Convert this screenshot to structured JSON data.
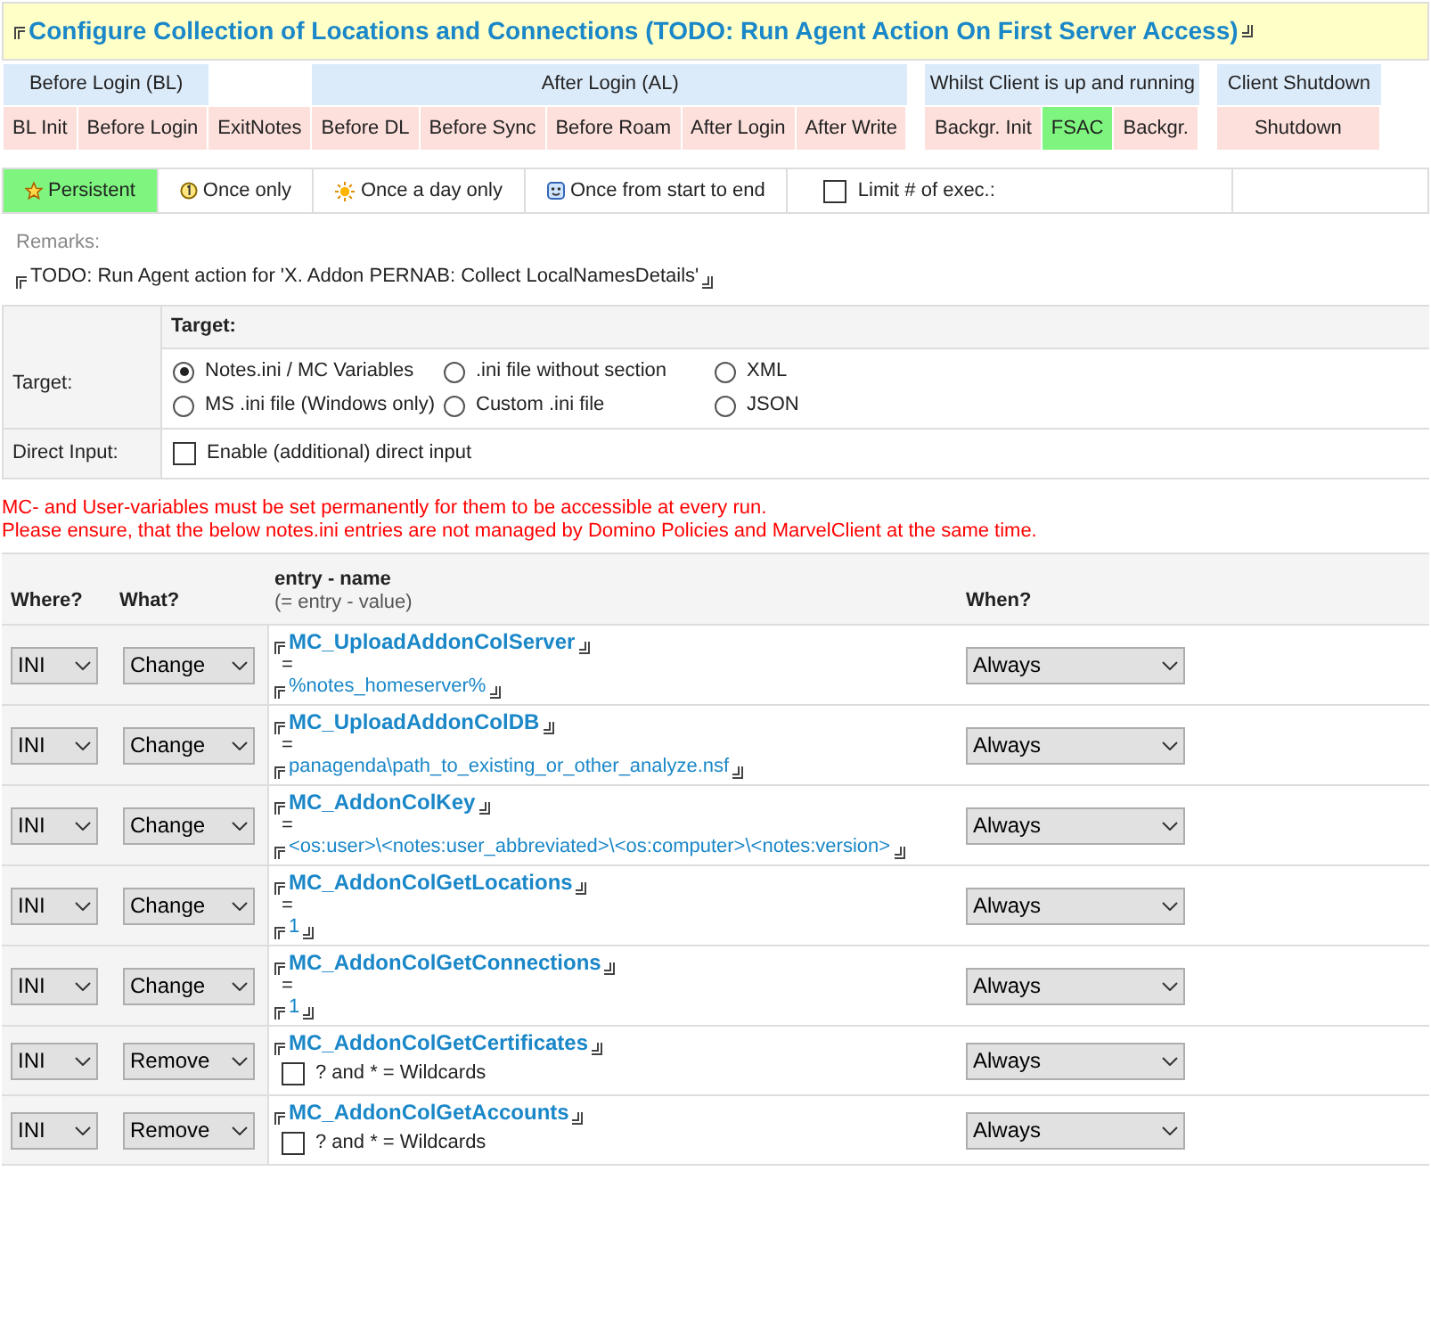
{
  "title": "Configure Collection of Locations and Connections (TODO: Run Agent Action On First Server Access)",
  "phase_groups": [
    {
      "label": "Before Login (BL)",
      "phases": [
        {
          "label": "BL Init",
          "selected": false
        },
        {
          "label": "Before Login",
          "selected": false
        }
      ]
    },
    {
      "phases": [
        {
          "label": "ExitNotes",
          "selected": false
        }
      ]
    },
    {
      "label": "After Login (AL)",
      "phases": [
        {
          "label": "Before DL",
          "selected": false
        },
        {
          "label": "Before Sync",
          "selected": false
        },
        {
          "label": "Before Roam",
          "selected": false
        },
        {
          "label": "After Login",
          "selected": false
        },
        {
          "label": "After Write",
          "selected": false
        }
      ]
    },
    {
      "label": "Whilst Client is up and running",
      "phases": [
        {
          "label": "Backgr. Init",
          "selected": false
        },
        {
          "label": "FSAC",
          "selected": true
        },
        {
          "label": "Backgr.",
          "selected": false
        }
      ]
    },
    {
      "label": "Client Shutdown",
      "phases": [
        {
          "label": "Shutdown",
          "selected": false
        }
      ]
    }
  ],
  "frequency": [
    {
      "label": "Persistent",
      "kind": "star",
      "selected": true
    },
    {
      "label": "Once only",
      "kind": "one",
      "selected": false
    },
    {
      "label": "Once a day only",
      "kind": "sun",
      "selected": false
    },
    {
      "label": "Once from start to end",
      "kind": "face",
      "selected": false
    }
  ],
  "limit": {
    "label": "Limit # of exec.:",
    "checked": false
  },
  "remarks": {
    "label": "Remarks:",
    "text": "TODO: Run Agent action for 'X. Addon PERNAB: Collect LocalNamesDetails'"
  },
  "target": {
    "row_label": "Target:",
    "heading": "Target:",
    "options": [
      {
        "label": "Notes.ini / MC Variables",
        "selected": true
      },
      {
        "label": ".ini file without section",
        "selected": false
      },
      {
        "label": "XML",
        "selected": false
      },
      {
        "label": "MS .ini file (Windows only)",
        "selected": false
      },
      {
        "label": "Custom .ini file",
        "selected": false
      },
      {
        "label": "JSON",
        "selected": false
      }
    ]
  },
  "direct_input": {
    "row_label": "Direct Input:",
    "label": "Enable (additional) direct input",
    "checked": false
  },
  "warnings": [
    "MC- and User-variables must be set permanently for them to be accessible at every run.",
    "Please ensure, that the below notes.ini entries are not managed by Domino Policies and MarvelClient at the same time."
  ],
  "entries_table": {
    "columns": [
      "Where?",
      "What?",
      "entry - name",
      "(= entry - value)",
      "When?"
    ],
    "rows": [
      {
        "kind": "change",
        "where": "INI",
        "what": "Change",
        "name": "MC_UploadAddonColServer",
        "equals": "=",
        "value": "%notes_homeserver%",
        "when": "Always"
      },
      {
        "kind": "change",
        "where": "INI",
        "what": "Change",
        "name": "MC_UploadAddonColDB",
        "equals": "=",
        "value": "panagenda\\path_to_existing_or_other_analyze.nsf",
        "when": "Always"
      },
      {
        "kind": "change",
        "where": "INI",
        "what": "Change",
        "name": "MC_AddonColKey",
        "equals": "=",
        "value": "<os:user>\\<notes:user_abbreviated>\\<os:computer>\\<notes:version>",
        "when": "Always"
      },
      {
        "kind": "change",
        "where": "INI",
        "what": "Change",
        "name": "MC_AddonColGetLocations",
        "equals": "=",
        "value": "1",
        "when": "Always"
      },
      {
        "kind": "change",
        "where": "INI",
        "what": "Change",
        "name": "MC_AddonColGetConnections",
        "equals": "=",
        "value": "1",
        "when": "Always"
      },
      {
        "kind": "remove",
        "where": "INI",
        "what": "Remove",
        "name": "MC_AddonColGetCertificates",
        "wildcards": {
          "label": "? and * = Wildcards",
          "checked": false
        },
        "when": "Always"
      },
      {
        "kind": "remove",
        "where": "INI",
        "what": "Remove",
        "name": "MC_AddonColGetAccounts",
        "wildcards": {
          "label": "? and * = Wildcards",
          "checked": false
        },
        "when": "Always"
      }
    ]
  }
}
